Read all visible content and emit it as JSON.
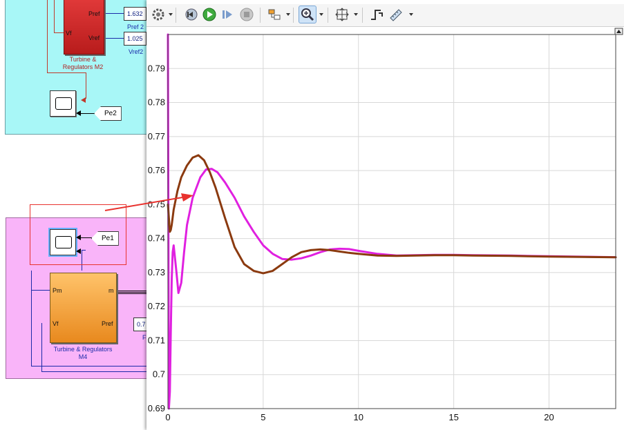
{
  "model": {
    "upper_block": {
      "port_pref": "Pref",
      "port_vref": "Vref",
      "port_vf": "Vf",
      "caption": "Turbine & Regulators M2"
    },
    "pref2_const": "1.632",
    "pref2_label": "Pref 2",
    "vref2_const": "1.025",
    "vref2_label": "Vref2",
    "pe2_tag": "Pe2",
    "pe1_tag": "Pe1",
    "lower_block": {
      "port_pm": "Pm",
      "port_m": "m",
      "port_vf": "Vf",
      "port_pref": "Pref",
      "caption": "Turbine & Regulators M4"
    },
    "lower_const": "0.7",
    "lower_const_label": "F"
  },
  "scope": {
    "toolbar": [
      {
        "name": "settings",
        "icon": "gear-icon"
      },
      {
        "name": "restart",
        "icon": "restart-icon"
      },
      {
        "name": "run",
        "icon": "play-icon"
      },
      {
        "name": "step-forward",
        "icon": "step-forward-icon"
      },
      {
        "name": "stop",
        "icon": "stop-icon"
      },
      {
        "name": "highlight-block",
        "icon": "block-highlight-icon"
      },
      {
        "name": "zoom-in",
        "icon": "zoom-in-icon"
      },
      {
        "name": "fit-to-view",
        "icon": "fit-view-icon"
      },
      {
        "name": "triggers",
        "icon": "trigger-icon"
      },
      {
        "name": "measure",
        "icon": "ruler-icon"
      }
    ],
    "colors": {
      "accent": "#e020e0",
      "series2": "#8b3a0f",
      "grid": "#d8d8d8",
      "annotation": "#e8322e"
    }
  },
  "chart_data": {
    "type": "line",
    "xlim": [
      0,
      23.5
    ],
    "ylim": [
      0.69,
      0.8
    ],
    "xticks": [
      "0",
      "5",
      "10",
      "15",
      "20"
    ],
    "xtick_values": [
      0,
      5,
      10,
      15,
      20
    ],
    "yticks": [
      "0.69",
      "0.7",
      "0.71",
      "0.72",
      "0.73",
      "0.74",
      "0.75",
      "0.76",
      "0.77",
      "0.78",
      "0.79"
    ],
    "ytick_values": [
      0.69,
      0.7,
      0.71,
      0.72,
      0.73,
      0.74,
      0.75,
      0.76,
      0.77,
      0.78,
      0.79
    ],
    "grid": true,
    "series": [
      {
        "color": "#e020e0",
        "x": [
          0,
          0.05,
          0.1,
          0.15,
          0.2,
          0.25,
          0.3,
          0.45,
          0.55,
          0.7,
          0.85,
          1.0,
          1.3,
          1.7,
          2.0,
          2.3,
          2.6,
          3.0,
          3.5,
          4.0,
          4.5,
          5.0,
          5.5,
          6.0,
          6.5,
          7.0,
          7.5,
          8.0,
          8.5,
          9.0,
          9.5,
          10.0,
          11.0,
          12.0,
          13.0,
          14.0,
          15.0,
          16.0,
          18.0,
          20.0,
          23.5
        ],
        "y": [
          0.8,
          0.69,
          0.695,
          0.712,
          0.728,
          0.736,
          0.738,
          0.73,
          0.724,
          0.727,
          0.736,
          0.744,
          0.752,
          0.758,
          0.7603,
          0.7605,
          0.7595,
          0.7565,
          0.752,
          0.7465,
          0.742,
          0.738,
          0.7355,
          0.734,
          0.7338,
          0.7342,
          0.735,
          0.736,
          0.7368,
          0.737,
          0.7369,
          0.7364,
          0.7355,
          0.735,
          0.7351,
          0.7352,
          0.7352,
          0.7351,
          0.735,
          0.7348,
          0.7345
        ]
      },
      {
        "color": "#8b3a0f",
        "x": [
          0,
          0.05,
          0.1,
          0.15,
          0.2,
          0.3,
          0.5,
          0.7,
          1.0,
          1.3,
          1.6,
          1.9,
          2.2,
          2.5,
          3.0,
          3.5,
          4.0,
          4.5,
          5.0,
          5.5,
          6.0,
          6.5,
          7.0,
          7.5,
          8.0,
          8.5,
          9.0,
          9.5,
          10.0,
          11.0,
          12.0,
          13.0,
          14.0,
          15.0,
          16.0,
          18.0,
          20.0,
          23.5
        ],
        "y": [
          0.75,
          0.746,
          0.742,
          0.7425,
          0.744,
          0.7485,
          0.754,
          0.758,
          0.7615,
          0.7638,
          0.7645,
          0.763,
          0.7595,
          0.755,
          0.746,
          0.7375,
          0.7325,
          0.7305,
          0.7298,
          0.7305,
          0.7325,
          0.7345,
          0.736,
          0.7366,
          0.7368,
          0.7366,
          0.7362,
          0.7358,
          0.7355,
          0.735,
          0.7349,
          0.735,
          0.7351,
          0.7351,
          0.735,
          0.7349,
          0.7347,
          0.7345
        ]
      }
    ]
  }
}
